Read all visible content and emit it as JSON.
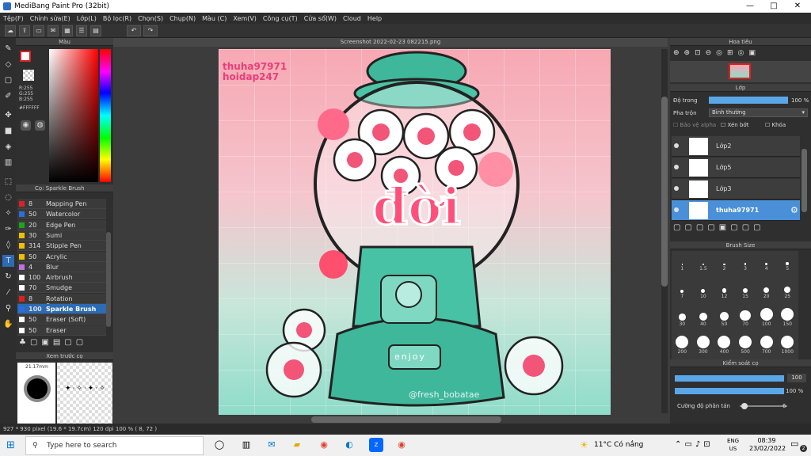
{
  "window": {
    "title": "MediBang Paint Pro (32bit)",
    "min": "—",
    "max": "□",
    "close": "✕"
  },
  "menu": [
    "Tệp(F)",
    "Chỉnh sửa(E)",
    "Lớp(L)",
    "Bộ lọc(R)",
    "Chọn(S)",
    "Chụp(N)",
    "Màu (C)",
    "Xem(V)",
    "Công cụ(T)",
    "Cửa sổ(W)",
    "Cloud",
    "Help"
  ],
  "color_panel": {
    "title": "Màu",
    "r": "R:255",
    "g": "G:255",
    "b": "B:255",
    "hex": "#FFFFFF"
  },
  "brush_panel": {
    "title": "Cọ: Sparkle Brush",
    "items": [
      {
        "color": "#e02020",
        "size": "8",
        "name": "Mapping Pen"
      },
      {
        "color": "#2a6fdb",
        "size": "50",
        "name": "Watercolor"
      },
      {
        "color": "#18a818",
        "size": "20",
        "name": "Edge Pen"
      },
      {
        "color": "#f0c000",
        "size": "30",
        "name": "Sumi"
      },
      {
        "color": "#f0c000",
        "size": "314",
        "name": "Stipple Pen"
      },
      {
        "color": "#f0c000",
        "size": "50",
        "name": "Acrylic"
      },
      {
        "color": "#c070e0",
        "size": "4",
        "name": "Blur"
      },
      {
        "color": "#ffffff",
        "size": "100",
        "name": "Airbrush"
      },
      {
        "color": "#ffffff",
        "size": "70",
        "name": "Smudge"
      },
      {
        "color": "#e02020",
        "size": "8",
        "name": "Rotation Symmetry"
      },
      {
        "color": "#2a6fdb",
        "size": "100",
        "name": "Sparkle Brush",
        "selected": true
      },
      {
        "color": "#ffffff",
        "size": "50",
        "name": "Eraser (Soft)"
      },
      {
        "color": "#ffffff",
        "size": "50",
        "name": "Eraser"
      }
    ]
  },
  "preview_panel": {
    "title": "Xem trước cọ",
    "size": "21.17mm"
  },
  "canvas": {
    "filename": "Screenshot 2022-02-23 082215.png",
    "watermark1": "thuha97971",
    "watermark2": "hoidap247",
    "big_text": "đời",
    "label": "enjoy",
    "credit": "@fresh_bobatae"
  },
  "navigator": {
    "title": "Hoa tiêu"
  },
  "layer_panel": {
    "title": "Lớp",
    "opacity_label": "Độ trong",
    "opacity_value": "100 %",
    "opacity": 1.0,
    "blend_label": "Pha trộn",
    "blend_value": "Bình thường",
    "protect_alpha": "Bảo vệ alpha",
    "clip": "Xén bớt",
    "lock": "Khóa",
    "layers": [
      {
        "name": "Lớp2"
      },
      {
        "name": "Lớp5"
      },
      {
        "name": "Lớp3"
      },
      {
        "name": "thuha97971",
        "selected": true
      }
    ]
  },
  "brush_size_panel": {
    "title": "Brush Size",
    "sizes": [
      "1",
      "1.5",
      "2",
      "3",
      "4",
      "5",
      "7",
      "10",
      "12",
      "15",
      "20",
      "25",
      "30",
      "40",
      "50",
      "70",
      "100",
      "150",
      "200",
      "300",
      "400",
      "500",
      "700",
      "1000"
    ]
  },
  "brush_control": {
    "title": "Kiểm soát cọ",
    "size_value": "100",
    "size": 1.0,
    "opacity_value": "100 %",
    "opacity": 1.0,
    "scatter_label": "Cường độ phân tán",
    "scatter_value": "6"
  },
  "status": {
    "dimensions": "927 * 930 pixel",
    "physical": "(19.6 * 19.7cm)",
    "dpi": "120 dpi",
    "zoom": "100 %",
    "coords": "( 8, 72 )"
  },
  "taskbar": {
    "search_placeholder": "Type here to search",
    "weather": "11°C Có nắng",
    "lang1": "ENG",
    "lang2": "US",
    "time": "08:39",
    "date": "23/02/2022",
    "notif": "2"
  }
}
